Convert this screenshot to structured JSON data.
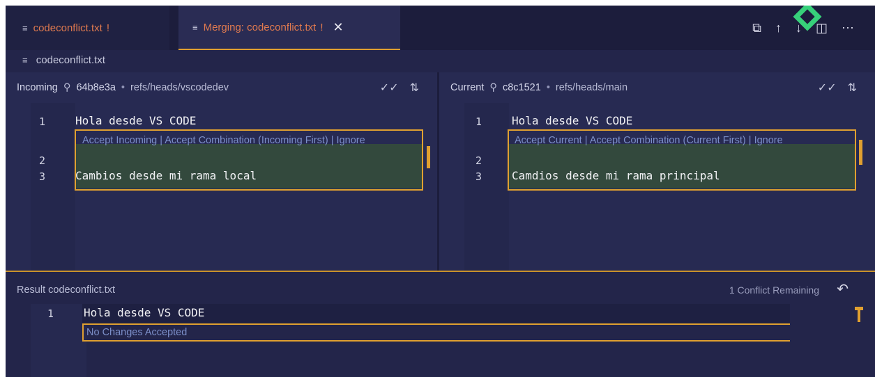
{
  "tabs": [
    {
      "label": "codeconflict.txt",
      "modified": "!"
    },
    {
      "label": "Merging: codeconflict.txt",
      "modified": "!",
      "close": "✕"
    }
  ],
  "toolbar_icons": [
    "open-file-icon",
    "arrow-up-icon",
    "arrow-down-icon",
    "split-icon",
    "more-icon"
  ],
  "breadcrumb": "codeconflict.txt",
  "incoming": {
    "label": "Incoming",
    "commit": "64b8e3a",
    "ref": "refs/heads/vscodedev",
    "lens": "Accept Incoming | Accept Combination (Incoming First) | Ignore",
    "lines": [
      {
        "num": "1",
        "text": "Hola desde VS CODE"
      },
      {
        "num": "2",
        "text": ""
      },
      {
        "num": "3",
        "text": "Cambios desde mi rama local"
      }
    ]
  },
  "current": {
    "label": "Current",
    "commit": "c8c1521",
    "ref": "refs/heads/main",
    "lens": "Accept Current | Accept Combination (Current First) | Ignore",
    "lines": [
      {
        "num": "1",
        "text": "Hola desde VS CODE"
      },
      {
        "num": "2",
        "text": ""
      },
      {
        "num": "3",
        "text": "Camdios desde mi rama principal"
      }
    ]
  },
  "result": {
    "label": "Result",
    "file": "codeconflict.txt",
    "conflicts": "1 Conflict Remaining",
    "lens": "No Changes Accepted",
    "lines": [
      {
        "num": "1",
        "text": "Hola desde VS CODE"
      }
    ]
  },
  "colors": {
    "accent": "#e0a030",
    "tab_modified": "#e07a4f",
    "editor_bg": "#272a52",
    "lens_text": "#7c8fc9"
  }
}
